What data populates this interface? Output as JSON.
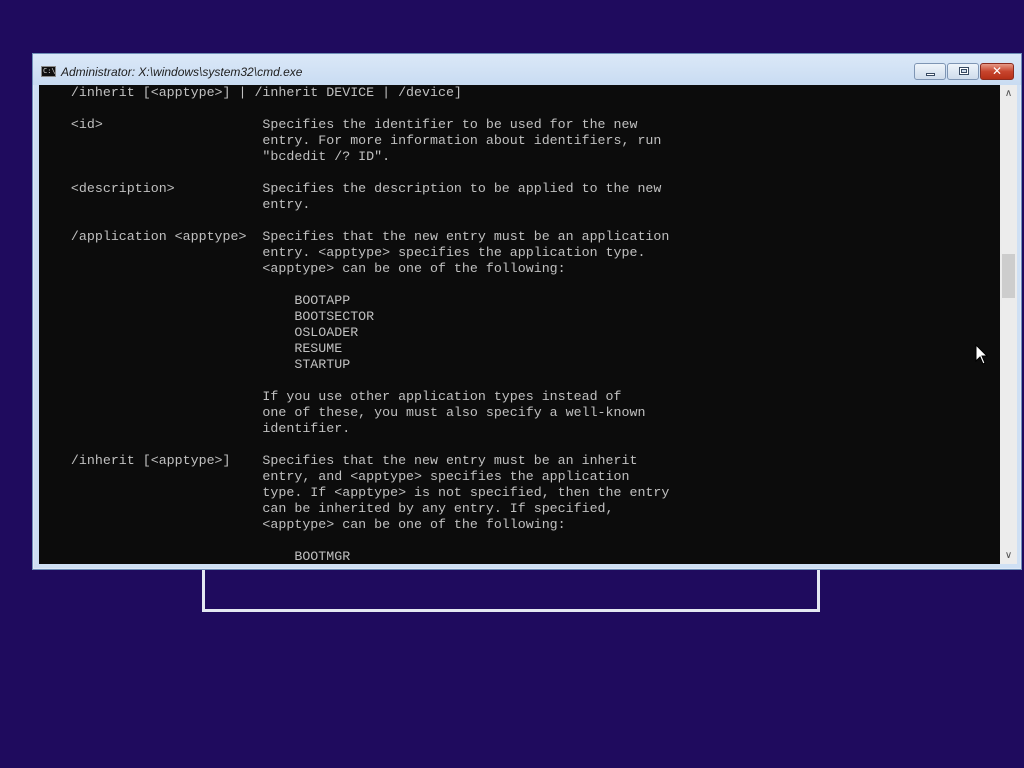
{
  "window": {
    "title": "Administrator: X:\\windows\\system32\\cmd.exe",
    "icon_label": "C:\\",
    "close_glyph": "✕"
  },
  "icons": {
    "app": "cmd-icon",
    "minimize": "minimize-icon",
    "maximize": "restore-icon",
    "close": "close-icon",
    "scroll_up": "chevron-up-icon",
    "scroll_down": "chevron-down-icon",
    "cursor": "mouse-pointer-icon"
  },
  "scrollbar": {
    "up_glyph": "∧",
    "down_glyph": "∨"
  },
  "colors": {
    "desktop_background": "#1f0b5e",
    "console_background": "#0c0c0c",
    "console_text": "#c0c0c0",
    "close_button": "#c7442d"
  },
  "console": {
    "lines": [
      "    /inherit [<apptype>] | /inherit DEVICE | /device]",
      "",
      "    <id>                    Specifies the identifier to be used for the new",
      "                            entry. For more information about identifiers, run",
      "                            \"bcdedit /? ID\".",
      "",
      "    <description>           Specifies the description to be applied to the new",
      "                            entry.",
      "",
      "    /application <apptype>  Specifies that the new entry must be an application",
      "                            entry. <apptype> specifies the application type.",
      "                            <apptype> can be one of the following:",
      "",
      "                                BOOTAPP",
      "                                BOOTSECTOR",
      "                                OSLOADER",
      "                                RESUME",
      "                                STARTUP",
      "",
      "                            If you use other application types instead of",
      "                            one of these, you must also specify a well-known",
      "                            identifier.",
      "",
      "    /inherit [<apptype>]    Specifies that the new entry must be an inherit",
      "                            entry, and <apptype> specifies the application",
      "                            type. If <apptype> is not specified, then the entry",
      "                            can be inherited by any entry. If specified,",
      "                            <apptype> can be one of the following:",
      "",
      "                                BOOTMGR"
    ]
  }
}
